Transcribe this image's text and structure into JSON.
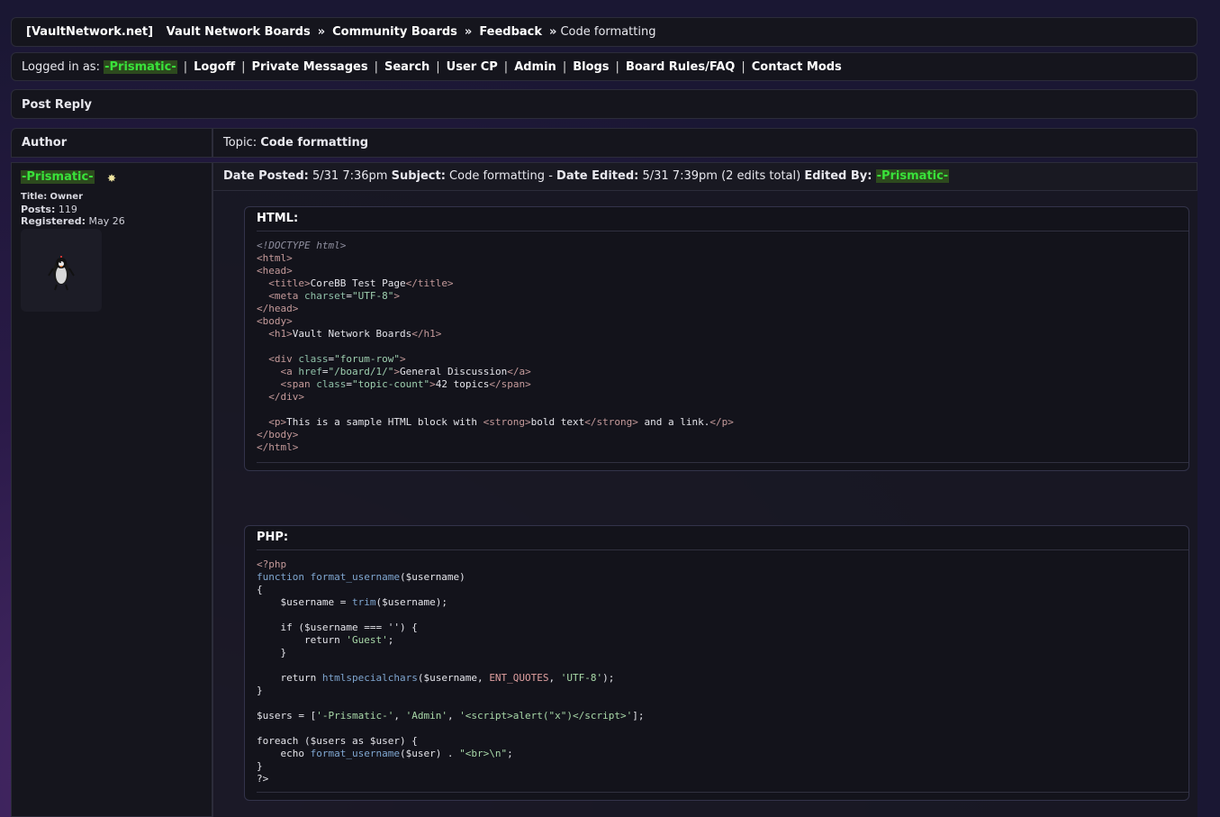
{
  "breadcrumb": {
    "site": "[VaultNetwork.net]",
    "items": [
      "Vault Network Boards",
      "Community Boards",
      "Feedback"
    ],
    "separator": "»",
    "current": "Code formatting"
  },
  "userbar": {
    "logged_in_label": "Logged in as:",
    "username": "-Prismatic-",
    "links": [
      "Logoff",
      "Private Messages",
      "Search",
      "User CP",
      "Admin",
      "Blogs",
      "Board Rules/FAQ",
      "Contact Mods"
    ],
    "separator": "|"
  },
  "post_reply_label": "Post Reply",
  "table_header": {
    "author_label": "Author",
    "topic_label": "Topic:",
    "topic_title": "Code formatting"
  },
  "author": {
    "name": "-Prismatic-",
    "title_label": "Title:",
    "title_value": "Owner",
    "posts_label": "Posts:",
    "posts_value": "119",
    "registered_label": "Registered:",
    "registered_value": "May 26"
  },
  "post_header": {
    "date_posted_label": "Date Posted:",
    "date_posted": "5/31 7:36pm",
    "subject_label": "Subject:",
    "subject": "Code formatting",
    "dash": "-",
    "date_edited_label": "Date Edited:",
    "date_edited": "5/31 7:39pm",
    "edits": "(2 edits total)",
    "edited_by_label": "Edited By:",
    "edited_by": "-Prismatic-"
  },
  "code_blocks": [
    {
      "label": "HTML:"
    },
    {
      "label": "PHP:"
    }
  ],
  "colors": {
    "username_green": "#39e23a",
    "username_bg": "#2d4a1e",
    "panel": "#15151d"
  }
}
